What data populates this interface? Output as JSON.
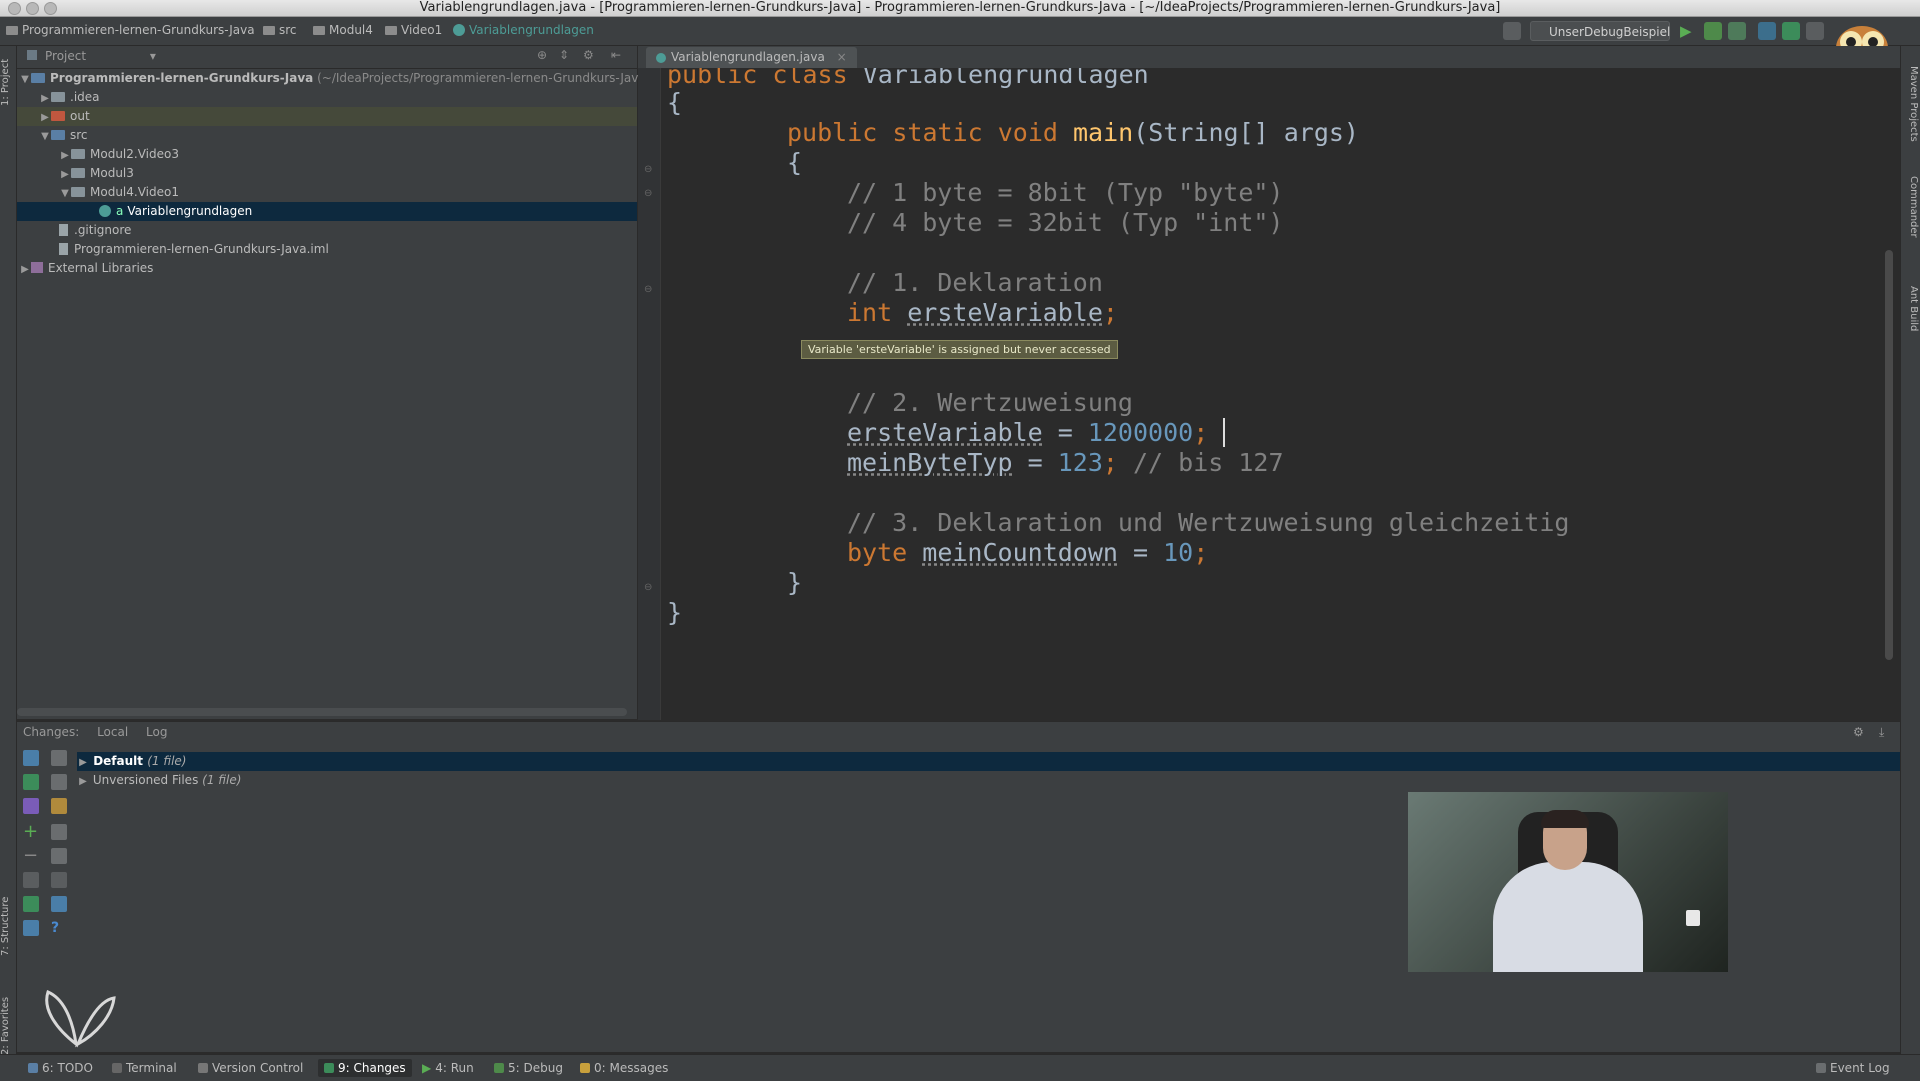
{
  "window": {
    "title": "Variablengrundlagen.java - [Programmieren-lernen-Grundkurs-Java] - Programmieren-lernen-Grundkurs-Java - [~/IdeaProjects/Programmieren-lernen-Grundkurs-Java]"
  },
  "navbar": {
    "crumbs": [
      "Programmieren-lernen-Grundkurs-Java",
      "src",
      "Modul4",
      "Video1",
      "Variablengrundlagen"
    ],
    "run_config": "UnserDebugBeispiel"
  },
  "left_strip": {
    "project_tab": "1: Project",
    "structure_tab": "7: Structure",
    "favorites_tab": "2: Favorites"
  },
  "right_strip": {
    "maven": "Maven Projects",
    "commander": "Commander",
    "ant": "Ant Build"
  },
  "project": {
    "header": "Project",
    "tree": [
      {
        "label": "Programmieren-lernen-Grundkurs-Java",
        "hint": "(~/IdeaProjects/Programmieren-lernen-Grundkurs-Java)"
      },
      {
        "label": ".idea"
      },
      {
        "label": "out"
      },
      {
        "label": "src"
      },
      {
        "label": "Modul2.Video3"
      },
      {
        "label": "Modul3"
      },
      {
        "label": "Modul4.Video1"
      },
      {
        "label": "Variablengrundlagen"
      },
      {
        "label": ".gitignore"
      },
      {
        "label": "Programmieren-lernen-Grundkurs-Java.iml"
      },
      {
        "label": "External Libraries"
      }
    ]
  },
  "editor": {
    "tab": "Variablengrundlagen.java",
    "tooltip": "Variable 'ersteVariable' is assigned but never accessed",
    "lines": {
      "l1_kw1": "public",
      "l1_kw2": "class",
      "l1_name": "Variablengrundlagen",
      "l2": "{",
      "l3_kw": "public static void",
      "l3_fn": "main",
      "l3_rest": "(String[] args)",
      "l4": "{",
      "l5": "// 1 byte = 8bit (Typ \"byte\")",
      "l6": "// 4 byte = 32bit (Typ \"int\")",
      "l7": "// 1. Deklaration",
      "l8_kw": "int",
      "l8_var": "ersteVariable",
      "l8_end": ";",
      "l10": "// 2. Wertzuweisung",
      "l11_var": "ersteVariable",
      "l11_op": " = ",
      "l11_num": "1200000",
      "l11_end": ";",
      "l12_var": "meinByteTyp",
      "l12_op": " = ",
      "l12_num": "123",
      "l12_end": ";",
      "l12_cm": " // bis 127",
      "l14": "// 3. Deklaration und Wertzuweisung gleichzeitig",
      "l15_kw": "byte",
      "l15_var": "meinCountdown",
      "l15_op": " = ",
      "l15_num": "10",
      "l15_end": ";",
      "l16": "}",
      "l17": "}"
    }
  },
  "changes": {
    "label": "Changes:",
    "tabs": [
      "Local",
      "Log"
    ],
    "rows": [
      {
        "label": "Default",
        "count": "(1 file)"
      },
      {
        "label": "Unversioned Files",
        "count": "(1 file)"
      }
    ]
  },
  "statusbar": {
    "items": [
      "6: TODO",
      "Terminal",
      "Version Control",
      "9: Changes",
      "4: Run",
      "5: Debug",
      "0: Messages"
    ],
    "event_log": "Event Log"
  },
  "colors": {
    "keyword": "#cc7832",
    "function": "#ffc66d",
    "comment": "#808080",
    "number": "#6897bb",
    "selection": "#0d293e"
  }
}
